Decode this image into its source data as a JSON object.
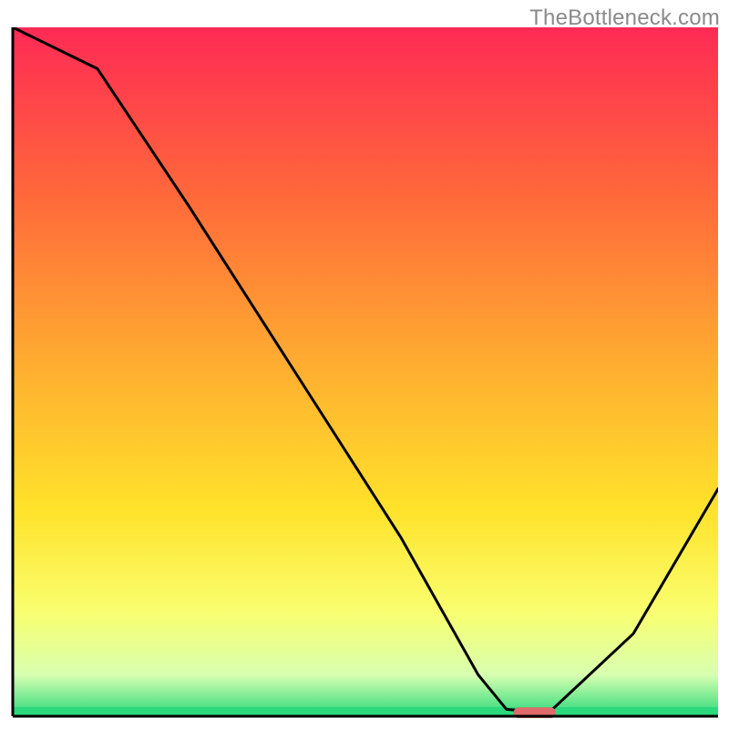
{
  "watermark": "TheBottleneck.com",
  "chart_data": {
    "type": "line",
    "title": "",
    "xlabel": "",
    "ylabel": "",
    "xlim": [
      0,
      100
    ],
    "ylim": [
      0,
      100
    ],
    "background_gradient": {
      "stops": [
        {
          "offset": 0.0,
          "color": "#ff2a55"
        },
        {
          "offset": 0.25,
          "color": "#ff6a3a"
        },
        {
          "offset": 0.5,
          "color": "#ffb030"
        },
        {
          "offset": 0.7,
          "color": "#ffe22a"
        },
        {
          "offset": 0.85,
          "color": "#f9ff70"
        },
        {
          "offset": 0.94,
          "color": "#d8ffb0"
        },
        {
          "offset": 1.0,
          "color": "#2bd97c"
        }
      ]
    },
    "series": [
      {
        "name": "bottleneck-curve",
        "color": "#000000",
        "x": [
          0,
          12,
          25,
          40,
          55,
          66,
          70,
          76,
          88,
          100
        ],
        "values": [
          100,
          94,
          74,
          50,
          26,
          6,
          1,
          0.5,
          12,
          33
        ]
      }
    ],
    "marker": {
      "name": "optimal-range",
      "color": "#e06a6a",
      "x_start": 71,
      "x_end": 77,
      "y": 0.5
    },
    "axes": {
      "show_border_left": true,
      "show_border_bottom": true,
      "border_color": "#000000"
    }
  }
}
